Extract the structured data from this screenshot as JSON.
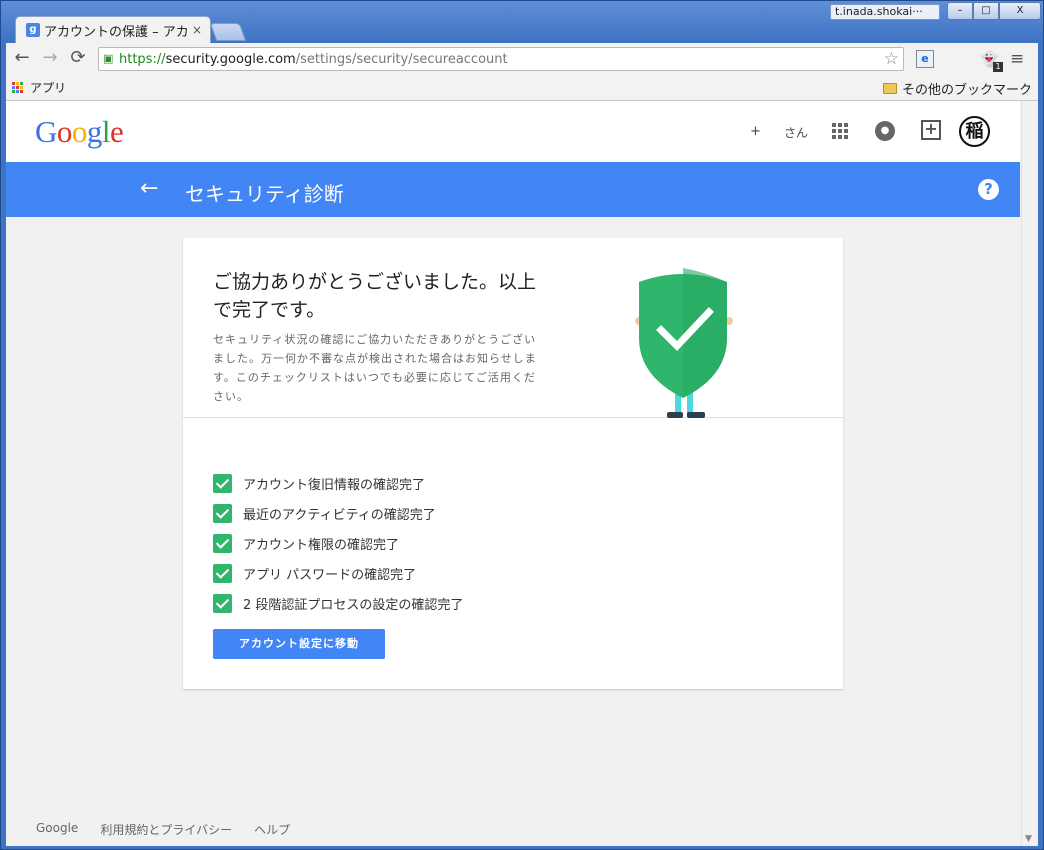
{
  "browser": {
    "tab_title": "アカウントの保護 – アカ",
    "tab_close": "×",
    "favicon_letter": "g",
    "profile_name": "t.inada.shokai···",
    "window_buttons": {
      "minimize": "–",
      "maximize": "□",
      "close": "X"
    },
    "nav": {
      "back": "←",
      "forward": "→",
      "reload": "⟳"
    },
    "url": {
      "scheme": "https://",
      "host": "security.google.com",
      "path": "/settings/security/secureaccount"
    },
    "star_icon": "☆",
    "ie_icon": "e",
    "ghost_icon": "👻",
    "ghost_badge": "1",
    "menu_icon": "≡",
    "bookmarks": {
      "apps": "アプリ",
      "other": "その他のブックマーク"
    },
    "apps_grid_colors": [
      "#e53935",
      "#fbbc05",
      "#34a853",
      "#4285f4",
      "#e53935",
      "#fbbc05",
      "#34a853",
      "#4285f4",
      "#e53935"
    ]
  },
  "header": {
    "logo_letters": [
      {
        "ch": "G",
        "color": "#3b73e6"
      },
      {
        "ch": "o",
        "color": "#d9352a"
      },
      {
        "ch": "o",
        "color": "#f4b400"
      },
      {
        "ch": "g",
        "color": "#3b73e6"
      },
      {
        "ch": "l",
        "color": "#30a14e"
      },
      {
        "ch": "e",
        "color": "#d9352a"
      }
    ],
    "plus": "+",
    "user_suffix": "さん",
    "notification_icon": "🔔",
    "share_icon": "+",
    "avatar_text": "稲"
  },
  "bar": {
    "back_icon": "←",
    "title": "セキュリティ診断",
    "help_icon": "?"
  },
  "card": {
    "heading": "ご協力ありがとうございました。以上で完了です。",
    "description": "セキュリティ状況の確認にご協力いただきありがとうございました。万一何か不審な点が検出された場合はお知らせします。このチェックリストはいつでも必要に応じてご活用ください。",
    "checklist": [
      "アカウント復旧情報の確認完了",
      "最近のアクティビティの確認完了",
      "アカウント権限の確認完了",
      "アプリ パスワードの確認完了",
      "2 段階認証プロセスの設定の確認完了"
    ],
    "button": "アカウント設定に移動"
  },
  "footer": {
    "links": [
      "Google",
      "利用規約とプライバシー",
      "ヘルプ"
    ]
  },
  "colors": {
    "accent_blue": "#4285f4",
    "check_green": "#2fb56c",
    "shield_green": "#2fb56c"
  }
}
